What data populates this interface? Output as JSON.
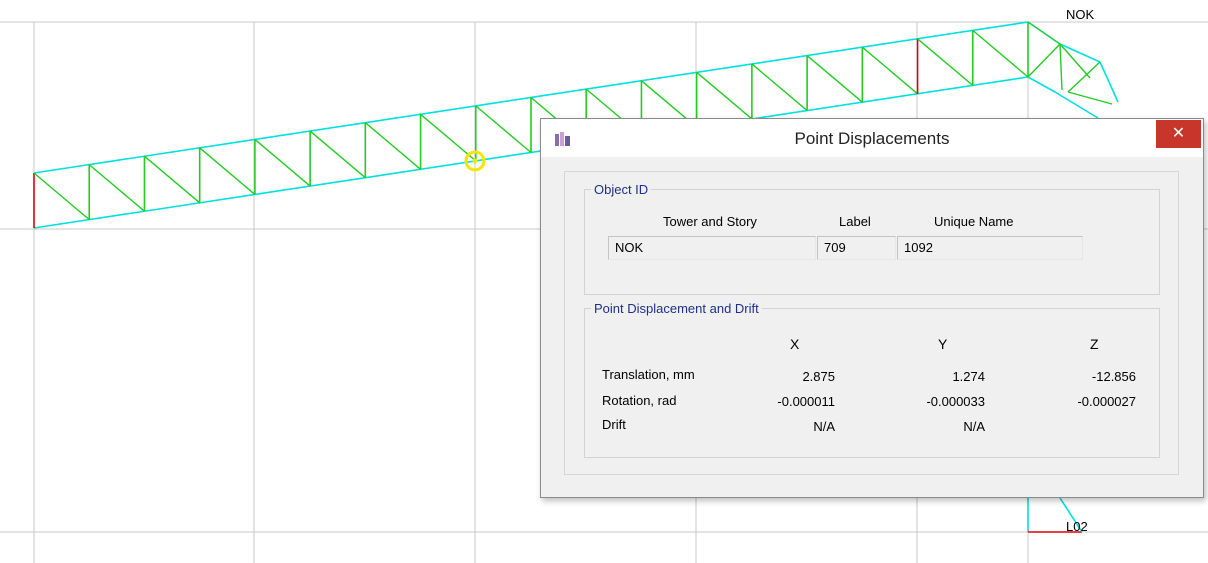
{
  "model": {
    "story_labels": {
      "top": "NOK",
      "bottom": "L02"
    },
    "colors": {
      "grid": "#c8c8c8",
      "chord": "#00e0e0",
      "web": "#22cc22",
      "support": "#dd0000",
      "selection": "#f0e800"
    }
  },
  "dialog": {
    "title": "Point Displacements",
    "app_icon": "etabs-app-icon",
    "close_glyph": "✕",
    "object_id": {
      "legend": "Object ID",
      "headers": {
        "tower_story": "Tower and Story",
        "label": "Label",
        "unique_name": "Unique Name"
      },
      "values": {
        "tower_story": "NOK",
        "label": "709",
        "unique_name": "1092"
      }
    },
    "displacement": {
      "legend": "Point Displacement and Drift",
      "axes": [
        "X",
        "Y",
        "Z"
      ],
      "rows": [
        {
          "label": "Translation, mm",
          "values": [
            "2.875",
            "1.274",
            "-12.856"
          ]
        },
        {
          "label": "Rotation, rad",
          "values": [
            "-0.000011",
            "-0.000033",
            "-0.000027"
          ]
        },
        {
          "label": "Drift",
          "values": [
            "N/A",
            "N/A",
            ""
          ]
        }
      ]
    }
  }
}
